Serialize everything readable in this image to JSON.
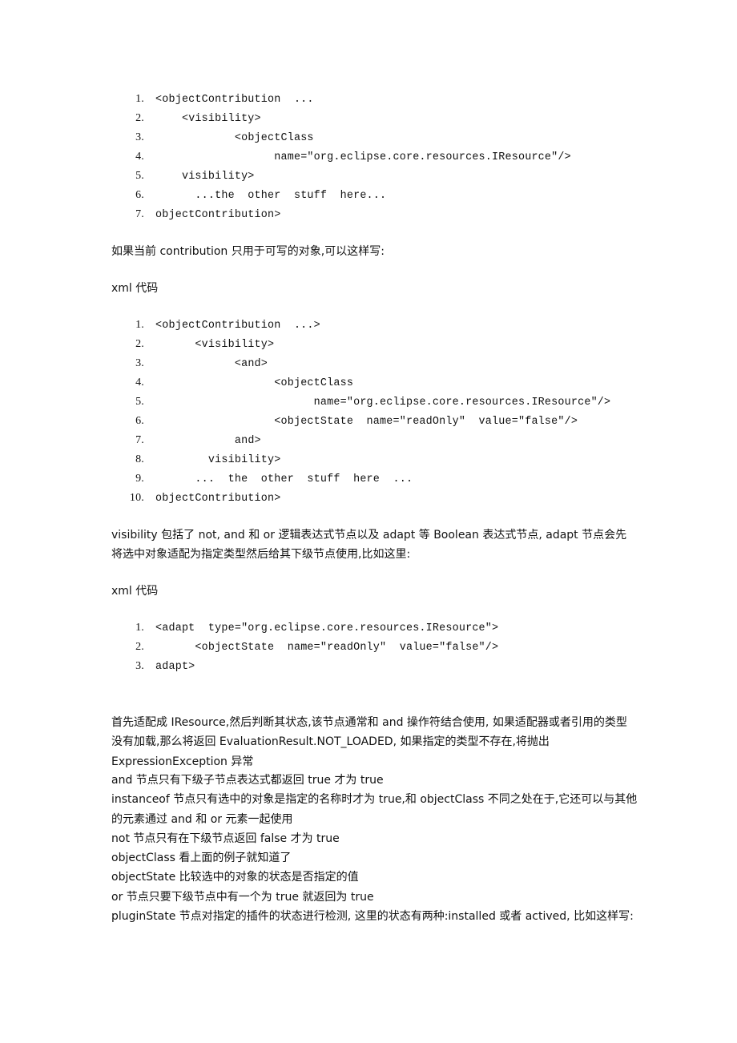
{
  "code_block_1": {
    "lines": [
      {
        "num": "1.",
        "indent": "",
        "text": "<objectContribution  ..."
      },
      {
        "num": "2.",
        "indent": "    ",
        "text": "<visibility>"
      },
      {
        "num": "3.",
        "indent": "            ",
        "text": "<objectClass"
      },
      {
        "num": "4.",
        "indent": "                  ",
        "text": "name=\"org.eclipse.core.resources.IResource\"/>"
      },
      {
        "num": "5.",
        "indent": "    ",
        "text": "visibility>"
      },
      {
        "num": "6.",
        "indent": "      ",
        "text": "...the  other  stuff  here..."
      },
      {
        "num": "7.",
        "indent": "",
        "text": "objectContribution>"
      }
    ]
  },
  "paragraph_1": "如果当前 contribution 只用于可写的对象,可以这样写:",
  "code_label_1": "xml 代码",
  "code_block_2": {
    "lines": [
      {
        "num": "1.",
        "indent": "",
        "text": "<objectContribution  ...>"
      },
      {
        "num": "2.",
        "indent": "      ",
        "text": "<visibility>"
      },
      {
        "num": "3.",
        "indent": "            ",
        "text": "<and>"
      },
      {
        "num": "4.",
        "indent": "                  ",
        "text": "<objectClass"
      },
      {
        "num": "5.",
        "indent": "                        ",
        "text": "name=\"org.eclipse.core.resources.IResource\"/>"
      },
      {
        "num": "6.",
        "indent": "                  ",
        "text": "<objectState  name=\"readOnly\"  value=\"false\"/>"
      },
      {
        "num": "7.",
        "indent": "            ",
        "text": "and>"
      },
      {
        "num": "8.",
        "indent": "        ",
        "text": "visibility>"
      },
      {
        "num": "9.",
        "indent": "      ",
        "text": "...  the  other  stuff  here  ..."
      },
      {
        "num": "10.",
        "indent": "",
        "text": "objectContribution>"
      }
    ]
  },
  "paragraph_2": "visibility 包括了 not, and 和 or 逻辑表达式节点以及 adapt 等 Boolean 表达式节点, adapt 节点会先将选中对象适配为指定类型然后给其下级节点使用,比如这里:",
  "code_label_2": "xml 代码",
  "code_block_3": {
    "lines": [
      {
        "num": "1.",
        "indent": "",
        "text": "<adapt  type=\"org.eclipse.core.resources.IResource\">"
      },
      {
        "num": "2.",
        "indent": "      ",
        "text": "<objectState  name=\"readOnly\"  value=\"false\"/>"
      },
      {
        "num": "3.",
        "indent": "",
        "text": "adapt>"
      }
    ]
  },
  "paragraph_3": "首先适配成 IResource,然后判断其状态,该节点通常和 and 操作符结合使用, 如果适配器或者引用的类型没有加载,那么将返回 EvaluationResult.NOT_LOADED, 如果指定的类型不存在,将抛出 ExpressionException 异常",
  "descriptions": [
    "and 节点只有下级子节点表达式都返回 true 才为 true",
    "instanceof 节点只有选中的对象是指定的名称时才为 true,和 objectClass 不同之处在于,它还可以与其他的元素通过 and 和 or 元素一起使用",
    "not 节点只有在下级节点返回 false 才为 true",
    "objectClass 看上面的例子就知道了",
    "objectState 比较选中的对象的状态是否指定的值",
    "or 节点只要下级节点中有一个为 true 就返回为 true",
    "pluginState 节点对指定的插件的状态进行检测, 这里的状态有两种:installed 或者 actived, 比如这样写:"
  ]
}
